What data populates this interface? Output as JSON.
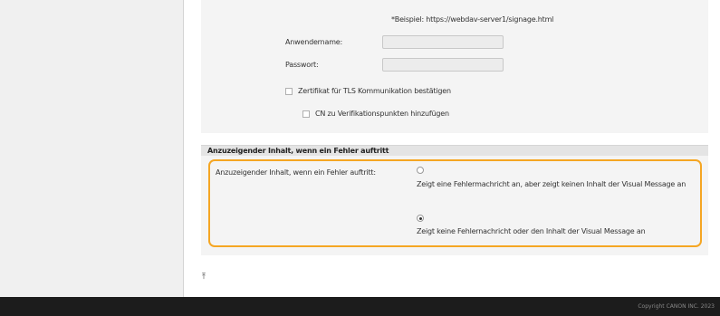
{
  "settings": {
    "url_hint": "*Beispiel: https://webdav-server1/signage.html",
    "username_label": "Anwendername:",
    "username_value": "",
    "password_label": "Passwort:",
    "password_value": "",
    "tls_label": "Zertifikat für TLS Kommunikation bestätigen",
    "cn_label": "CN zu Verifikationspunkten hinzufügen"
  },
  "error_section": {
    "heading": "Anzuzeigender Inhalt, wenn ein Fehler auftritt",
    "field_label": "Anzuzeigender Inhalt, wenn ein Fehler auftritt:",
    "options": [
      {
        "label": "Zeigt eine Fehlermachricht an, aber zeigt keinen Inhalt der Visual Message an",
        "selected": false
      },
      {
        "label": "Zeigt keine Fehlernachricht oder den Inhalt der Visual Message an",
        "selected": true
      }
    ]
  },
  "page_top_icon": "page-top-icon",
  "footer": {
    "copyright": "Copyright CANON INC. 2023"
  },
  "colors": {
    "highlight": "#f5a623",
    "footer": "#1c1c1c",
    "panel": "#f4f4f4"
  }
}
